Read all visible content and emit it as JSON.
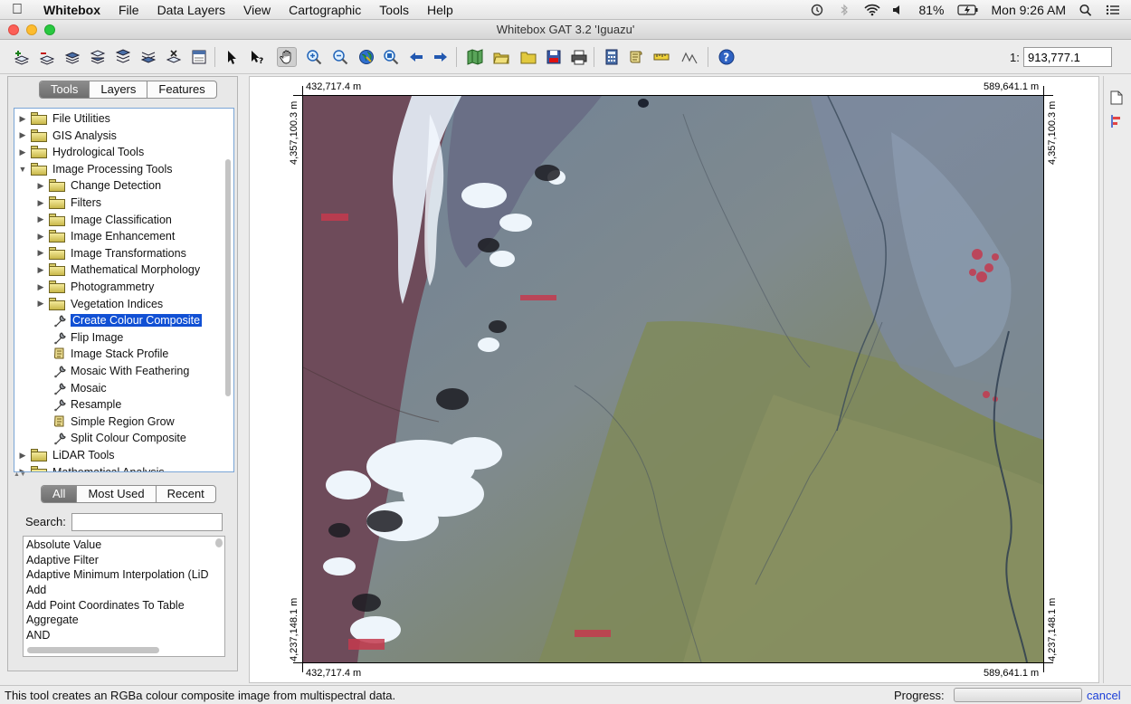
{
  "menubar": {
    "app_name": "Whitebox",
    "items": [
      "File",
      "Data Layers",
      "View",
      "Cartographic",
      "Tools",
      "Help"
    ],
    "battery": "81%",
    "clock": "Mon 9:26 AM"
  },
  "window": {
    "title": "Whitebox GAT 3.2 'Iguazu'"
  },
  "toolbar": {
    "scale_label": "1:",
    "scale_value": "913,777.1",
    "buttons": [
      "add-layer",
      "remove-layer",
      "raise-layer",
      "lower-layer",
      "layer-to-top",
      "layer-to-bottom",
      "clear-layers",
      "layer-properties",
      "select",
      "select-feature",
      "pan",
      "zoom-in",
      "zoom-out",
      "full-extent",
      "zoom-to-layer",
      "previous-extent",
      "next-extent",
      "new-map",
      "open-map",
      "open-file",
      "save-map",
      "print-map",
      "calculator",
      "scripter",
      "measure",
      "profile",
      "help"
    ]
  },
  "left_panel": {
    "tabs": [
      "Tools",
      "Layers",
      "Features"
    ],
    "selected_tab": "Tools",
    "tree": [
      {
        "label": "File Utilities",
        "type": "folder",
        "level": 0,
        "expanded": false
      },
      {
        "label": "GIS Analysis",
        "type": "folder",
        "level": 0,
        "expanded": false
      },
      {
        "label": "Hydrological Tools",
        "type": "folder",
        "level": 0,
        "expanded": false
      },
      {
        "label": "Image Processing Tools",
        "type": "folder",
        "level": 0,
        "expanded": true
      },
      {
        "label": "Change Detection",
        "type": "folder",
        "level": 1,
        "expanded": false
      },
      {
        "label": "Filters",
        "type": "folder",
        "level": 1,
        "expanded": false
      },
      {
        "label": "Image Classification",
        "type": "folder",
        "level": 1,
        "expanded": false
      },
      {
        "label": "Image Enhancement",
        "type": "folder",
        "level": 1,
        "expanded": false
      },
      {
        "label": "Image Transformations",
        "type": "folder",
        "level": 1,
        "expanded": false
      },
      {
        "label": "Mathematical Morphology",
        "type": "folder",
        "level": 1,
        "expanded": false
      },
      {
        "label": "Photogrammetry",
        "type": "folder",
        "level": 1,
        "expanded": false
      },
      {
        "label": "Vegetation Indices",
        "type": "folder",
        "level": 1,
        "expanded": false
      },
      {
        "label": "Create Colour Composite",
        "type": "tool",
        "level": 1,
        "selected": true
      },
      {
        "label": "Flip Image",
        "type": "tool",
        "level": 1
      },
      {
        "label": "Image Stack Profile",
        "type": "script",
        "level": 1
      },
      {
        "label": "Mosaic With Feathering",
        "type": "tool",
        "level": 1
      },
      {
        "label": "Mosaic",
        "type": "tool",
        "level": 1
      },
      {
        "label": "Resample",
        "type": "tool",
        "level": 1
      },
      {
        "label": "Simple Region Grow",
        "type": "script",
        "level": 1
      },
      {
        "label": "Split Colour Composite",
        "type": "tool",
        "level": 1
      },
      {
        "label": "LiDAR Tools",
        "type": "folder",
        "level": 0,
        "expanded": false
      },
      {
        "label": "Mathematical Analysis",
        "type": "folder",
        "level": 0,
        "expanded": false
      }
    ],
    "list_tabs": [
      "All",
      "Most Used",
      "Recent"
    ],
    "selected_list_tab": "All",
    "search_label": "Search:",
    "search_value": "",
    "tool_list": [
      "Absolute Value",
      "Adaptive Filter",
      "Adaptive Minimum Interpolation (LiD",
      "Add",
      "Add Point Coordinates To Table",
      "Aggregate",
      "AND"
    ]
  },
  "map": {
    "top_left_x": "432,717.4 m",
    "top_right_x": "589,641.1 m",
    "bottom_left_x": "432,717.4 m",
    "bottom_right_x": "589,641.1 m",
    "left_top_y": "4,357,100.3 m",
    "left_bottom_y": "4,237,148.1 m",
    "right_top_y": "4,357,100.3 m",
    "right_bottom_y": "4,237,148.1 m"
  },
  "status": {
    "message": "This tool creates an RGBa colour composite image from multispectral data.",
    "progress_label": "Progress:",
    "progress_value": 0,
    "cancel_label": "cancel"
  }
}
